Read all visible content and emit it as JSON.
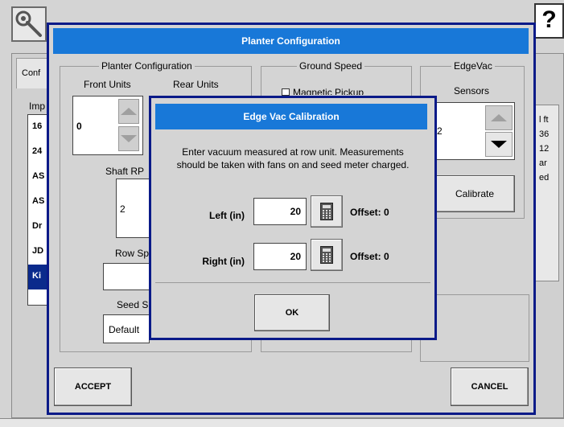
{
  "background": {
    "tab_label": "Conf",
    "list_header": "Imp",
    "implement_list": [
      "16",
      "24",
      "AS",
      "AS",
      "Dr",
      "JD",
      "Ki"
    ],
    "right_column": [
      "l ft",
      "36",
      "12",
      "ar",
      "ed"
    ],
    "help_label": "?"
  },
  "planter_config": {
    "title": "Planter Configuration",
    "group_label": "Planter Configuration",
    "front_units_label": "Front Units",
    "rear_units_label": "Rear Units",
    "front_units_value": "0",
    "shaft_rpm_label": "Shaft RP",
    "shaft_rpm_value": "2",
    "row_spacing_label": "Row Sp",
    "seed_label": "Seed S",
    "seed_value": "Default",
    "ground_speed_label": "Ground Speed",
    "magnetic_pickup_label": "Magnetic Pickup",
    "edgevac_label": "EdgeVac",
    "sensors_label": "Sensors",
    "sensors_value": "2",
    "calibrate_label": "Calibrate",
    "accept_label": "ACCEPT",
    "cancel_label": "CANCEL"
  },
  "edge_vac": {
    "title": "Edge Vac Calibration",
    "instruction_line1": "Enter vacuum measured at row unit. Measurements",
    "instruction_line2": "should be taken with fans on and seed meter charged.",
    "left_label": "Left (in)",
    "left_value": "20",
    "left_offset": "Offset: 0",
    "right_label": "Right (in)",
    "right_value": "20",
    "right_offset": "Offset: 0",
    "ok_label": "OK"
  },
  "colors": {
    "title_bar": "#1878d8",
    "window_border": "#0a1a88",
    "selection": "#0a2a8c",
    "background": "#d4d4d4"
  },
  "icons": [
    "wrench-icon",
    "help-icon",
    "calculator-icon",
    "arrow-up-icon",
    "arrow-down-icon",
    "checkbox-icon"
  ]
}
